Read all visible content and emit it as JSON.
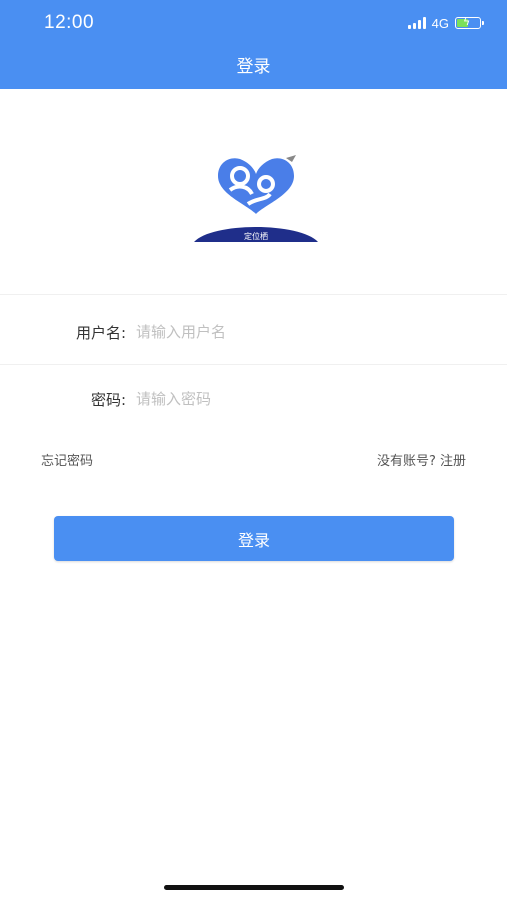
{
  "status_bar": {
    "time": "12:00",
    "network": "4G",
    "battery_fill": 0.5,
    "battery_color": "#7be05a"
  },
  "header": {
    "title": "登录",
    "background_color": "#4a8ff2"
  },
  "logo": {
    "icon": "heart-logo-icon",
    "text": "定位栖"
  },
  "form": {
    "username": {
      "label": "用户名:",
      "placeholder": "请输入用户名",
      "value": ""
    },
    "password": {
      "label": "密码:",
      "placeholder": "请输入密码",
      "value": ""
    }
  },
  "links": {
    "forgot_password": "忘记密码",
    "register": "没有账号? 注册"
  },
  "login_button": {
    "label": "登录",
    "color": "#4a8ff2"
  }
}
